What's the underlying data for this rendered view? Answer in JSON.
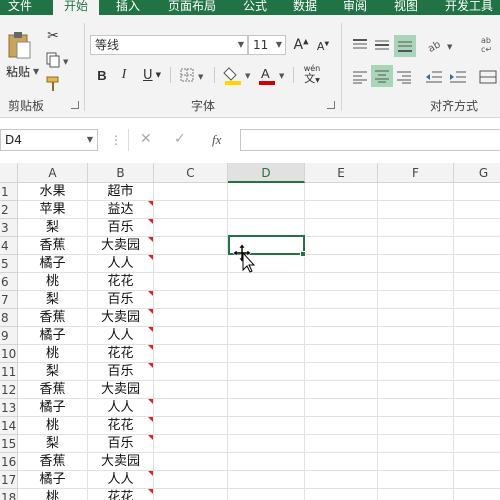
{
  "tabs": [
    "文件",
    "开始",
    "插入",
    "页面布局",
    "公式",
    "数据",
    "审阅",
    "视图",
    "开发工具"
  ],
  "clipboard": {
    "paste_label": "粘贴",
    "group_label": "剪贴板"
  },
  "font": {
    "name": "等线",
    "size": "11",
    "group_label": "字体",
    "wen_label": "wén"
  },
  "alignment": {
    "group_label": "对齐方式"
  },
  "formula_bar": {
    "cell_ref": "D4",
    "fx": "fx",
    "content": ""
  },
  "columns": [
    "A",
    "B",
    "C",
    "D",
    "E",
    "F",
    "G"
  ],
  "selected_column": "D",
  "rows": [
    {
      "n": "1",
      "a": "水果",
      "b": "超市",
      "flag": false
    },
    {
      "n": "2",
      "a": "苹果",
      "b": "益达",
      "flag": true
    },
    {
      "n": "3",
      "a": "梨",
      "b": "百乐",
      "flag": true
    },
    {
      "n": "4",
      "a": "香蕉",
      "b": "大卖园",
      "flag": true
    },
    {
      "n": "5",
      "a": "橘子",
      "b": "人人",
      "flag": true
    },
    {
      "n": "6",
      "a": "桃",
      "b": "花花",
      "flag": false
    },
    {
      "n": "7",
      "a": "梨",
      "b": "百乐",
      "flag": true
    },
    {
      "n": "8",
      "a": "香蕉",
      "b": "大卖园",
      "flag": true
    },
    {
      "n": "9",
      "a": "橘子",
      "b": "人人",
      "flag": true
    },
    {
      "n": "10",
      "a": "桃",
      "b": "花花",
      "flag": true
    },
    {
      "n": "11",
      "a": "梨",
      "b": "百乐",
      "flag": true
    },
    {
      "n": "12",
      "a": "香蕉",
      "b": "大卖园",
      "flag": false
    },
    {
      "n": "13",
      "a": "橘子",
      "b": "人人",
      "flag": true
    },
    {
      "n": "14",
      "a": "桃",
      "b": "花花",
      "flag": true
    },
    {
      "n": "15",
      "a": "梨",
      "b": "百乐",
      "flag": true
    },
    {
      "n": "16",
      "a": "香蕉",
      "b": "大卖园",
      "flag": false
    },
    {
      "n": "17",
      "a": "橘子",
      "b": "人人",
      "flag": true
    },
    {
      "n": "18",
      "a": "桃",
      "b": "花花",
      "flag": true
    }
  ],
  "colors": {
    "excel_green": "#217346",
    "flag_red": "#e0211f",
    "fill_yellow": "#ffd500",
    "font_red": "#d40000"
  }
}
